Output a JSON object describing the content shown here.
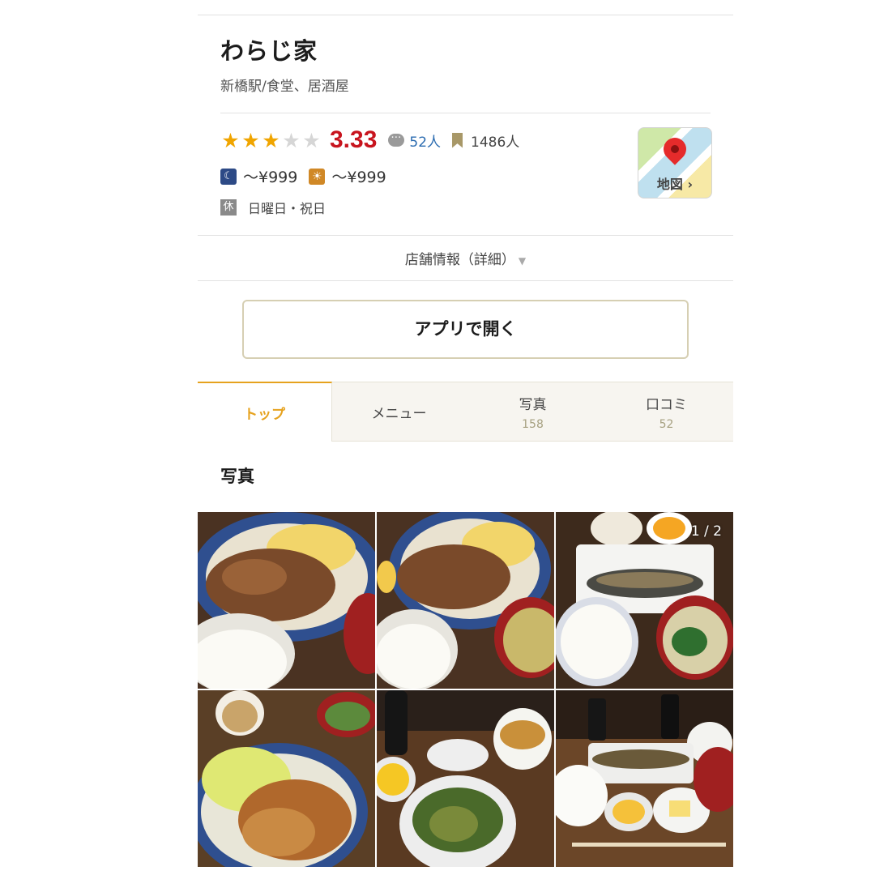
{
  "shop": {
    "name": "わらじ家",
    "genre": "新橋駅/食堂、居酒屋"
  },
  "rating": {
    "score": "3.33",
    "stars_filled": 3,
    "stars_total": 5,
    "reviews": "52人",
    "bookmarks": "1486人"
  },
  "prices": {
    "night_icon": "moon-icon",
    "night": "～¥999",
    "day_icon": "sun-icon",
    "day": "～¥999"
  },
  "holiday": {
    "badge": "休",
    "text": "日曜日・祝日"
  },
  "map": {
    "label": "地図 ›"
  },
  "detail_link": "店舗情報（詳細）",
  "open_app": "アプリで開く",
  "tabs": [
    {
      "label": "トップ",
      "count": ""
    },
    {
      "label": "メニュー",
      "count": ""
    },
    {
      "label": "写真",
      "count": "158"
    },
    {
      "label": "口コミ",
      "count": "52"
    }
  ],
  "photos": {
    "title": "写真",
    "counter": "1 / 2"
  },
  "colors": {
    "accent": "#e6a21e",
    "score": "#c8141e",
    "star": "#f0a500"
  }
}
